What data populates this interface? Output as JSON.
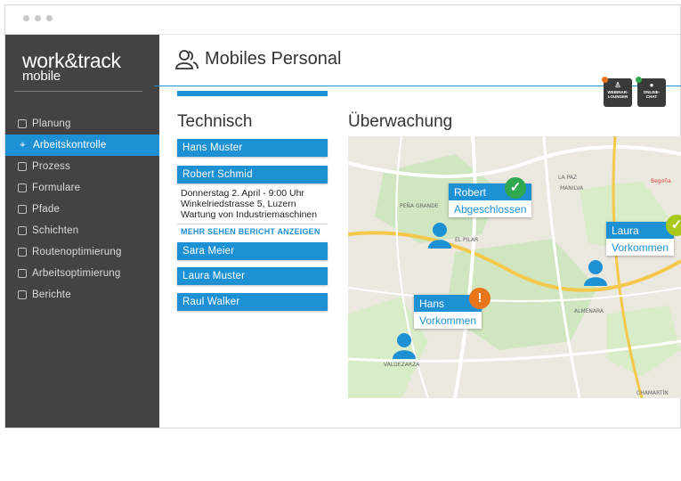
{
  "brand": {
    "main": "work&track",
    "sub": "mobile"
  },
  "nav": [
    {
      "label": "Planung",
      "icon": "chart-icon",
      "active": false
    },
    {
      "label": "Arbeitskontrolle",
      "icon": "target-icon",
      "active": true
    },
    {
      "label": "Prozess",
      "icon": "database-icon",
      "active": false
    },
    {
      "label": "Formulare",
      "icon": "form-icon",
      "active": false
    },
    {
      "label": "Pfade",
      "icon": "map-icon",
      "active": false
    },
    {
      "label": "Schichten",
      "icon": "calendar-icon",
      "active": false
    },
    {
      "label": "Routenoptimierung",
      "icon": "route-icon",
      "active": false
    },
    {
      "label": "Arbeitsoptimierung",
      "icon": "grid-icon",
      "active": false
    },
    {
      "label": "Berichte",
      "icon": "report-icon",
      "active": false
    }
  ],
  "header": {
    "title": "Mobiles Personal"
  },
  "actions": [
    {
      "label": "WEBINAR-\nLOUNGEN",
      "badge_color": "#e8751a",
      "icon": "user-icon"
    },
    {
      "label": "ONLINE-\nCHAT",
      "badge_color": "#2fa84f",
      "icon": "chat-icon"
    }
  ],
  "technisch": {
    "title": "Technisch",
    "people": [
      "Hans Muster",
      "Robert Schmid",
      "Sara Meier",
      "Laura Muster",
      "Raul Walker"
    ],
    "details": [
      "Donnerstag 2. April - 9:00 Uhr",
      "Winkelriedstrasse 5, Luzern",
      "Wartung von Industriemaschinen"
    ],
    "more": "MEHR SEHEN BERICHT ANZEIGEN"
  },
  "ueberwachung": {
    "title": "Überwachung",
    "markers": [
      {
        "name": "Robert",
        "status": "Abgeschlossen",
        "state": "done"
      },
      {
        "name": "Laura",
        "status": "Vorkommen",
        "state": "done"
      },
      {
        "name": "Hans",
        "status": "Vorkommen",
        "state": "warning"
      }
    ],
    "map_labels": [
      "LA PAZ",
      "MANILVA",
      "PEÑA GRANDE",
      "EL PILAR",
      "ALMENARA",
      "VALDEZARZA",
      "CHAMARTÍN",
      "Begoña"
    ]
  },
  "colors": {
    "accent": "#1e90d4",
    "sidebar": "#434343",
    "success": "#2fa84f",
    "warning": "#e8751a"
  }
}
